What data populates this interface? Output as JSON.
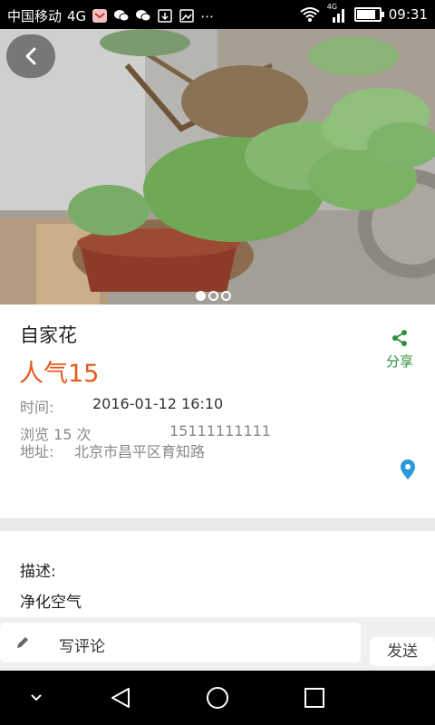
{
  "status_bar": {
    "carrier": "中国移动",
    "network": "4G",
    "signal_badge": "4G",
    "time": "09:31",
    "battery_level_percent": 85
  },
  "gallery": {
    "image_description": "potted plant photo",
    "page_count": 3,
    "active_page": 1
  },
  "detail": {
    "title": "自家花",
    "popularity": "人气15",
    "time_label": "时间:",
    "time_value": "2016-01-12 16:10",
    "views": "浏览 15 次",
    "phone": "15111111111",
    "address_label": "地址:",
    "address_value": "北京市昌平区育知路",
    "share_label": "分享"
  },
  "description": {
    "label": "描述:",
    "text": "净化空气"
  },
  "comment_bar": {
    "write_comment_label": "写评论",
    "send_label": "发送"
  },
  "colors": {
    "accent_orange": "#e55a1e",
    "share_green": "#2f8f3a",
    "location_blue": "#2a9bd8"
  }
}
